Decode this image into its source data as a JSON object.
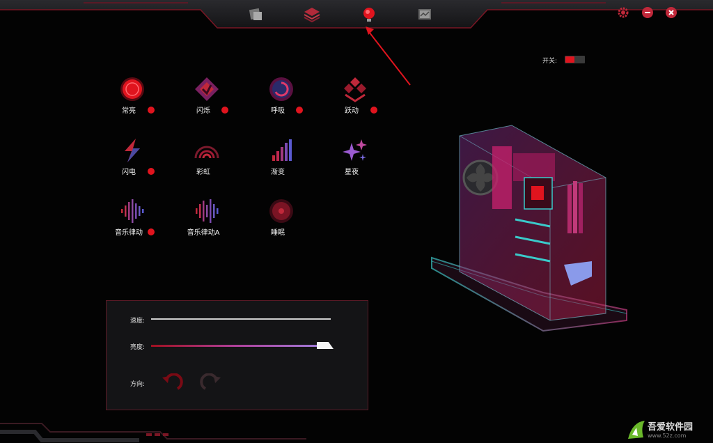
{
  "switch": {
    "label": "开关:",
    "on": true
  },
  "tabs": [
    {
      "name": "tab-profile-icon"
    },
    {
      "name": "tab-layers-icon"
    },
    {
      "name": "tab-lighting-icon",
      "active": true
    },
    {
      "name": "tab-monitor-icon"
    }
  ],
  "effects": [
    {
      "label": "常亮",
      "icon": "steady-icon",
      "dot": true
    },
    {
      "label": "闪烁",
      "icon": "flash-icon",
      "dot": true
    },
    {
      "label": "呼吸",
      "icon": "breath-icon",
      "dot": true
    },
    {
      "label": "跃动",
      "icon": "jump-icon",
      "dot": true
    },
    {
      "label": "闪电",
      "icon": "lightning-icon",
      "dot": true
    },
    {
      "label": "彩虹",
      "icon": "rainbow-icon",
      "dot": false
    },
    {
      "label": "渐变",
      "icon": "gradient-icon",
      "dot": false
    },
    {
      "label": "星夜",
      "icon": "star-night-icon",
      "dot": false
    },
    {
      "label": "音乐律动",
      "icon": "music-rhythm-icon",
      "dot": true
    },
    {
      "label": "音乐律动A",
      "icon": "music-rhythm-a-icon",
      "dot": false
    },
    {
      "label": "睡眠",
      "icon": "sleep-icon",
      "dot": false
    }
  ],
  "panel": {
    "speed_label": "速度:",
    "brightness_label": "亮度:",
    "direction_label": "方向:",
    "brightness_level": 1.0
  },
  "watermark": {
    "title": "吾爱软件园",
    "url": "www.52z.com"
  },
  "colors": {
    "accent": "#e0141e",
    "purple": "#a07ad8",
    "panel_border": "#5a1a26"
  }
}
